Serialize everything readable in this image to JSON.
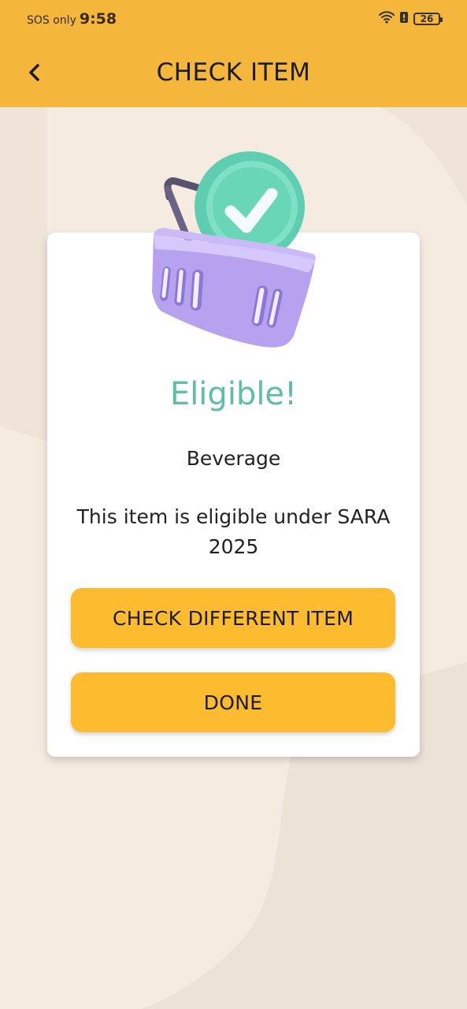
{
  "status_bar": {
    "carrier": "SOS only",
    "time": "9:58",
    "battery": "26",
    "icons": [
      "wifi-icon",
      "alert-icon",
      "battery-icon"
    ]
  },
  "app_bar": {
    "title": "CHECK ITEM",
    "back_icon": "chevron-left-icon"
  },
  "result": {
    "status": "Eligible!",
    "category": "Beverage",
    "message": "This item is eligible under SARA 2025",
    "illustration": "basket-check-icon"
  },
  "actions": {
    "check_different_label": "CHECK DIFFERENT ITEM",
    "done_label": "DONE"
  },
  "colors": {
    "header": "#f4b63b",
    "button": "#fdbb2f",
    "eligible_text": "#5cbfa6",
    "background": "#f5ebe0"
  }
}
